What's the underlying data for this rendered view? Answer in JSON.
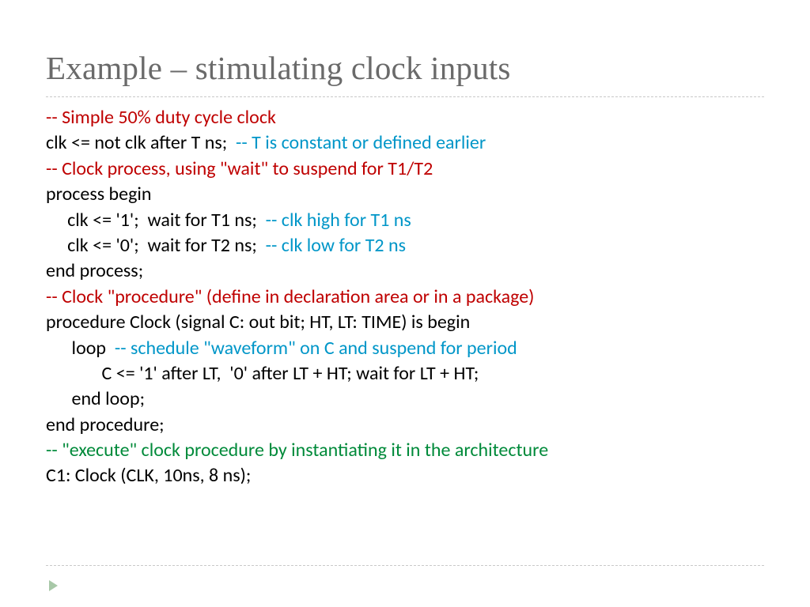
{
  "title": "Example – stimulating clock inputs",
  "lines": {
    "l1a": "-- Simple 50% duty cycle clock",
    "l2a": "clk <= not clk after T ns;  ",
    "l2b": "-- T is constant or defined earlier",
    "l3a": "-- Clock process, using \"wait\" to suspend for T1/T2",
    "l4a": "process begin",
    "l5a": "     clk <= '1';  wait for T1 ns;  ",
    "l5b": "-- clk high for T1 ns",
    "l6a": "     clk <= '0';  wait for T2 ns;  ",
    "l6b": "-- clk low for T2 ns",
    "l7a": "end process;",
    "l8a": "-- Clock \"procedure\" (define in declaration area or in a package)",
    "l9a": "procedure Clock (signal C: out bit; HT, LT: TIME) is begin",
    "l10a": "      loop  ",
    "l10b": "-- schedule \"waveform\" on C and suspend for period",
    "l11a": "             C <= '1' after LT,  '0' after LT + HT; wait for LT + HT;",
    "l12a": "      end loop;",
    "l13a": "end procedure;",
    "l14a": "-- \"execute\" clock procedure by instantiating it in the architecture",
    "l15a": "C1: Clock (CLK, 10ns, 8 ns);"
  }
}
